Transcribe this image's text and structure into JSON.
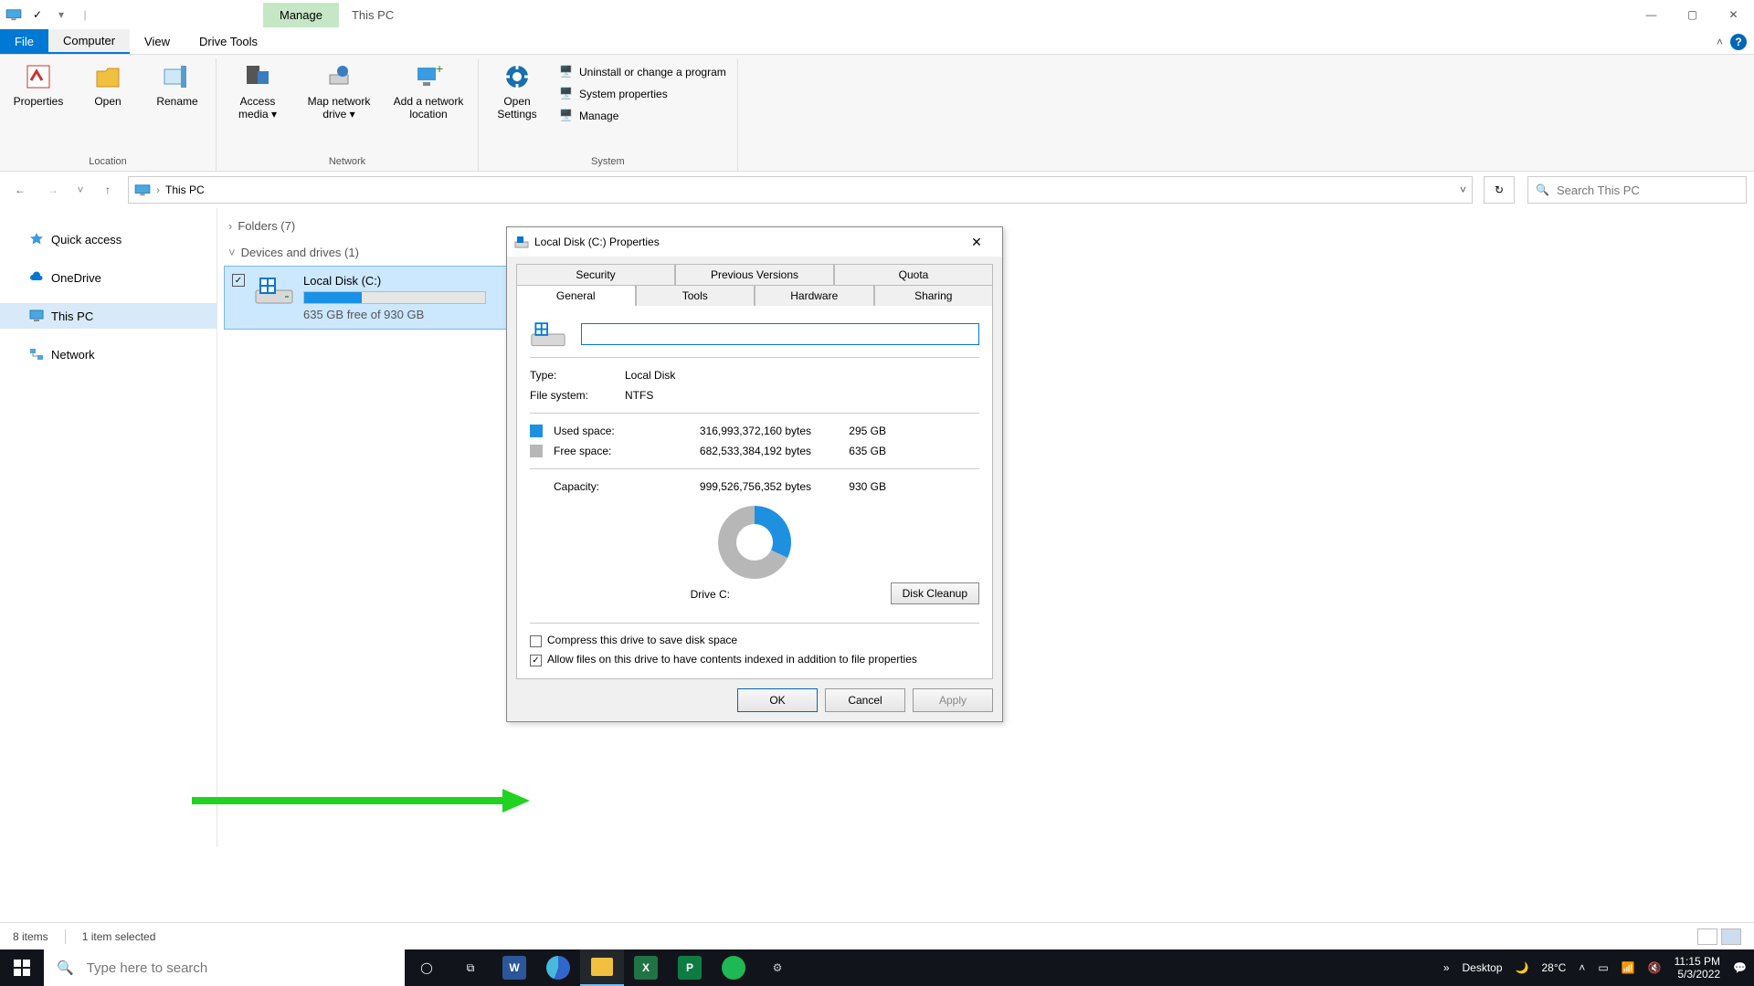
{
  "titlebar": {
    "context_tab": "Manage",
    "location": "This PC"
  },
  "winctl": {
    "min": "—",
    "max": "▢",
    "close": "✕"
  },
  "tabs": {
    "file": "File",
    "computer": "Computer",
    "view": "View",
    "drivetools": "Drive Tools"
  },
  "ribbon": {
    "location": {
      "properties": "Properties",
      "open": "Open",
      "rename": "Rename",
      "group": "Location"
    },
    "network": {
      "access": "Access media",
      "map": "Map network drive",
      "add": "Add a network location",
      "group": "Network"
    },
    "system": {
      "open": "Open Settings",
      "uninstall": "Uninstall or change a program",
      "props": "System properties",
      "manage": "Manage",
      "group": "System"
    }
  },
  "nav": {
    "back": "←",
    "fwd": "→",
    "up": "↑"
  },
  "addr": {
    "label": "This PC"
  },
  "search": {
    "placeholder": "Search This PC"
  },
  "navpane": {
    "quick": "Quick access",
    "onedrive": "OneDrive",
    "thispc": "This PC",
    "network": "Network"
  },
  "content": {
    "folders": "Folders (7)",
    "devices": "Devices and drives (1)",
    "drive_name": "Local Disk (C:)",
    "drive_free": "635 GB free of 930 GB"
  },
  "status": {
    "items": "8 items",
    "selected": "1 item selected"
  },
  "dialog": {
    "title": "Local Disk (C:) Properties",
    "tabs": {
      "security": "Security",
      "prev": "Previous Versions",
      "quota": "Quota",
      "general": "General",
      "tools": "Tools",
      "hardware": "Hardware",
      "sharing": "Sharing"
    },
    "name_value": "",
    "type_k": "Type:",
    "type_v": "Local Disk",
    "fs_k": "File system:",
    "fs_v": "NTFS",
    "used_k": "Used space:",
    "used_bytes": "316,993,372,160 bytes",
    "used_gb": "295 GB",
    "free_k": "Free space:",
    "free_bytes": "682,533,384,192 bytes",
    "free_gb": "635 GB",
    "cap_k": "Capacity:",
    "cap_bytes": "999,526,756,352 bytes",
    "cap_gb": "930 GB",
    "drive_label": "Drive C:",
    "cleanup": "Disk Cleanup",
    "compress": "Compress this drive to save disk space",
    "index": "Allow files on this drive to have contents indexed in addition to file properties",
    "ok": "OK",
    "cancel": "Cancel",
    "apply": "Apply"
  },
  "taskbar": {
    "search": "Type here to search",
    "desktop": "Desktop",
    "temp": "28°C",
    "time": "11:15 PM",
    "date": "5/3/2022"
  },
  "colors": {
    "used": "#1e90e0",
    "free": "#b7b7b7"
  }
}
